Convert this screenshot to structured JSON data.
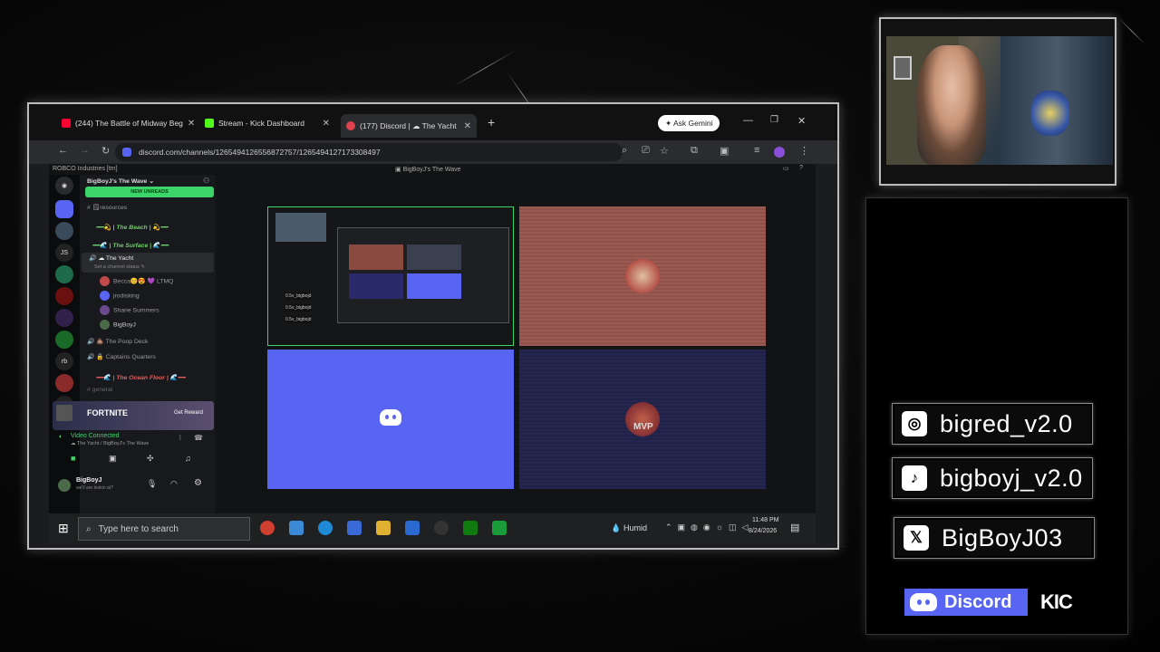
{
  "browser": {
    "tabs": [
      {
        "label": "(244) The Battle of Midway Beg",
        "color": "#ff0033"
      },
      {
        "label": "Stream - Kick Dashboard",
        "color": "#53fc18"
      },
      {
        "label": "(177) Discord | ☁ The Yacht",
        "color": "#e0414c"
      }
    ],
    "new_tab": "+",
    "gemini_label": "Ask Gemini",
    "url": "discord.com/channels/1265494126556872757/1265494127173308497"
  },
  "discord": {
    "org_label": "ROBCO Industries [tm]",
    "channel_header": "BigBoyJ's The Wave",
    "server_name": "BigBoyJ's The Wave",
    "new_unreads": "NEW UNREADS",
    "channels": [
      {
        "text": "# 🗒resources",
        "kind": "text"
      },
      {
        "text": "━━💫 | The Beach | 💫━━",
        "kind": "cat"
      },
      {
        "text": "━━🌊 | The Surface | 🌊━━",
        "kind": "cat"
      },
      {
        "text": "🔊 ☁ The Yacht",
        "kind": "voice"
      },
      {
        "text": "Set a channel status ✎",
        "kind": "status"
      }
    ],
    "voice_users": [
      "Becca😊😍 💜 LTMQ",
      "jrodisking",
      "Shane Summers",
      "BigBoyJ"
    ],
    "more_channels": [
      {
        "text": "🔊 💩 The Poop Deck",
        "kind": "voice"
      },
      {
        "text": "🔊 🔒 Captains Quarters",
        "kind": "voice"
      },
      {
        "text": "━━🌊 | The Ocean Floor | 🌊━━",
        "kind": "cat"
      },
      {
        "text": "# general",
        "kind": "text"
      }
    ],
    "promo_title": "FORTNITE",
    "promo_button": "Get Reward",
    "voice_status": "Video Connected",
    "voice_sub": "☁ The Yacht / BigBoyJ's The Wave",
    "user_name": "BigBoyJ",
    "user_status": "we'll are lookin at?",
    "tile_labels": [
      "0.5v_bigbojd",
      "0.5v_bigbojd",
      "0.5v_bigbojd"
    ],
    "tile_badge": "MVP"
  },
  "taskbar": {
    "search_placeholder": "Type here to search",
    "weather": "Humid",
    "time": "11:48 PM",
    "date": "8/24/2026"
  },
  "social": [
    {
      "icon": "instagram-icon",
      "handle": "bigred_v2.0"
    },
    {
      "icon": "tiktok-icon",
      "handle": "bigboyj_v2.0"
    },
    {
      "icon": "x-icon",
      "handle": "BigBoyJ03"
    }
  ],
  "footer": {
    "discord_label": "Discord",
    "kick_label": "KIC"
  },
  "colors": {
    "discord_blurple": "#5865f2",
    "kick_green": "#53fc18",
    "channel_green": "#3bd56a"
  }
}
